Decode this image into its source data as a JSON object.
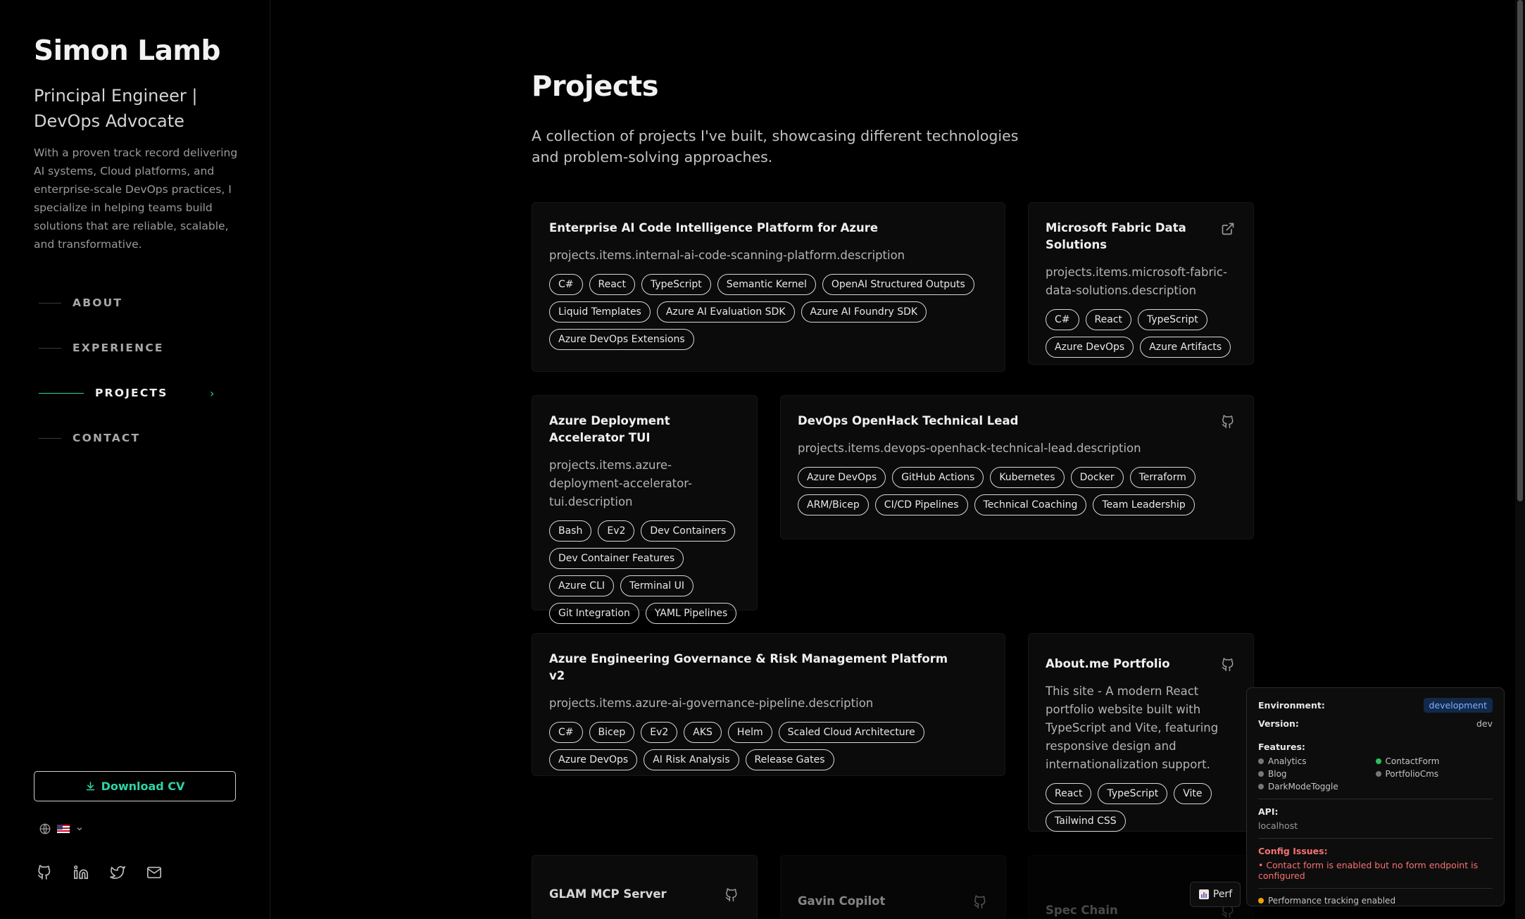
{
  "profile": {
    "name": "Simon Lamb",
    "role": "Principal Engineer | DevOps Advocate",
    "bio": "With a proven track record delivering AI systems, Cloud platforms, and enterprise-scale DevOps practices, I specialize in helping teams build solutions that are reliable, scalable, and transformative."
  },
  "nav": {
    "items": [
      {
        "label": "ABOUT"
      },
      {
        "label": "EXPERIENCE"
      },
      {
        "label": "PROJECTS"
      },
      {
        "label": "CONTACT"
      }
    ],
    "active": "PROJECTS",
    "active_chevron": "›"
  },
  "sidebar": {
    "download_cv": "Download CV",
    "language_icon": "globe-icon",
    "social_icons": [
      "github-icon",
      "linkedin-icon",
      "twitter-icon",
      "mail-icon"
    ]
  },
  "main": {
    "title": "Projects",
    "subtitle": "A collection of projects I've built, showcasing different technologies and problem-solving approaches."
  },
  "projects": [
    {
      "title": "Enterprise AI Code Intelligence Platform for Azure",
      "description": "projects.items.internal-ai-code-scanning-platform.description",
      "icon": "",
      "tags": [
        "C#",
        "React",
        "TypeScript",
        "Semantic Kernel",
        "OpenAI Structured Outputs",
        "Liquid Templates",
        "Azure AI Evaluation SDK",
        "Azure AI Foundry SDK",
        "Azure DevOps Extensions"
      ]
    },
    {
      "title": "Microsoft Fabric Data Solutions",
      "description": "projects.items.microsoft-fabric-data-solutions.description",
      "icon": "external-link-icon",
      "tags": [
        "C#",
        "React",
        "TypeScript",
        "Azure DevOps",
        "Azure Artifacts"
      ]
    },
    {
      "title": "Azure Deployment Accelerator TUI",
      "description": "projects.items.azure-deployment-accelerator-tui.description",
      "icon": "",
      "tags": [
        "Bash",
        "Ev2",
        "Dev Containers",
        "Dev Container Features",
        "Azure CLI",
        "Terminal UI",
        "Git Integration",
        "YAML Pipelines"
      ]
    },
    {
      "title": "DevOps OpenHack Technical Lead",
      "description": "projects.items.devops-openhack-technical-lead.description",
      "icon": "github-icon",
      "tags": [
        "Azure DevOps",
        "GitHub Actions",
        "Kubernetes",
        "Docker",
        "Terraform",
        "ARM/Bicep",
        "CI/CD Pipelines",
        "Technical Coaching",
        "Team Leadership"
      ]
    },
    {
      "title": "Azure Engineering Governance & Risk Management Platform v2",
      "description": "projects.items.azure-ai-governance-pipeline.description",
      "icon": "",
      "tags": [
        "C#",
        "Bicep",
        "Ev2",
        "AKS",
        "Helm",
        "Scaled Cloud Architecture",
        "Azure DevOps",
        "AI Risk Analysis",
        "Release Gates"
      ]
    },
    {
      "title": "About.me Portfolio",
      "description": "This site - A modern React portfolio website built with TypeScript and Vite, featuring responsive design and internationalization support.",
      "icon": "github-icon",
      "tags": [
        "React",
        "TypeScript",
        "Vite",
        "Tailwind CSS"
      ]
    },
    {
      "title": "GLAM MCP Server",
      "description": "",
      "icon": "github-icon",
      "tags": []
    },
    {
      "title": "Gavin Copilot",
      "description": "",
      "icon": "github-icon",
      "tags": []
    },
    {
      "title": "Spec Chain",
      "description": "",
      "icon": "github-icon",
      "tags": []
    }
  ],
  "devpanel": {
    "environment_label": "Environment:",
    "environment_value": "development",
    "version_label": "Version:",
    "version_value": "dev",
    "features_label": "Features:",
    "features": [
      {
        "name": "Analytics",
        "enabled": false
      },
      {
        "name": "ContactForm",
        "enabled": true
      },
      {
        "name": "Blog",
        "enabled": false
      },
      {
        "name": "PortfolioCms",
        "enabled": false
      },
      {
        "name": "DarkModeToggle",
        "enabled": false
      }
    ],
    "api_label": "API:",
    "api_value": "localhost",
    "issues_label": "Config Issues:",
    "issues": [
      "• Contact form is enabled but no form endpoint is configured"
    ],
    "perf_status": "Performance tracking enabled",
    "perf_button": "Perf"
  },
  "colors": {
    "accent": "#2dd4a7",
    "background": "#000000",
    "card": "#0b0b0b",
    "error": "#f87171"
  }
}
